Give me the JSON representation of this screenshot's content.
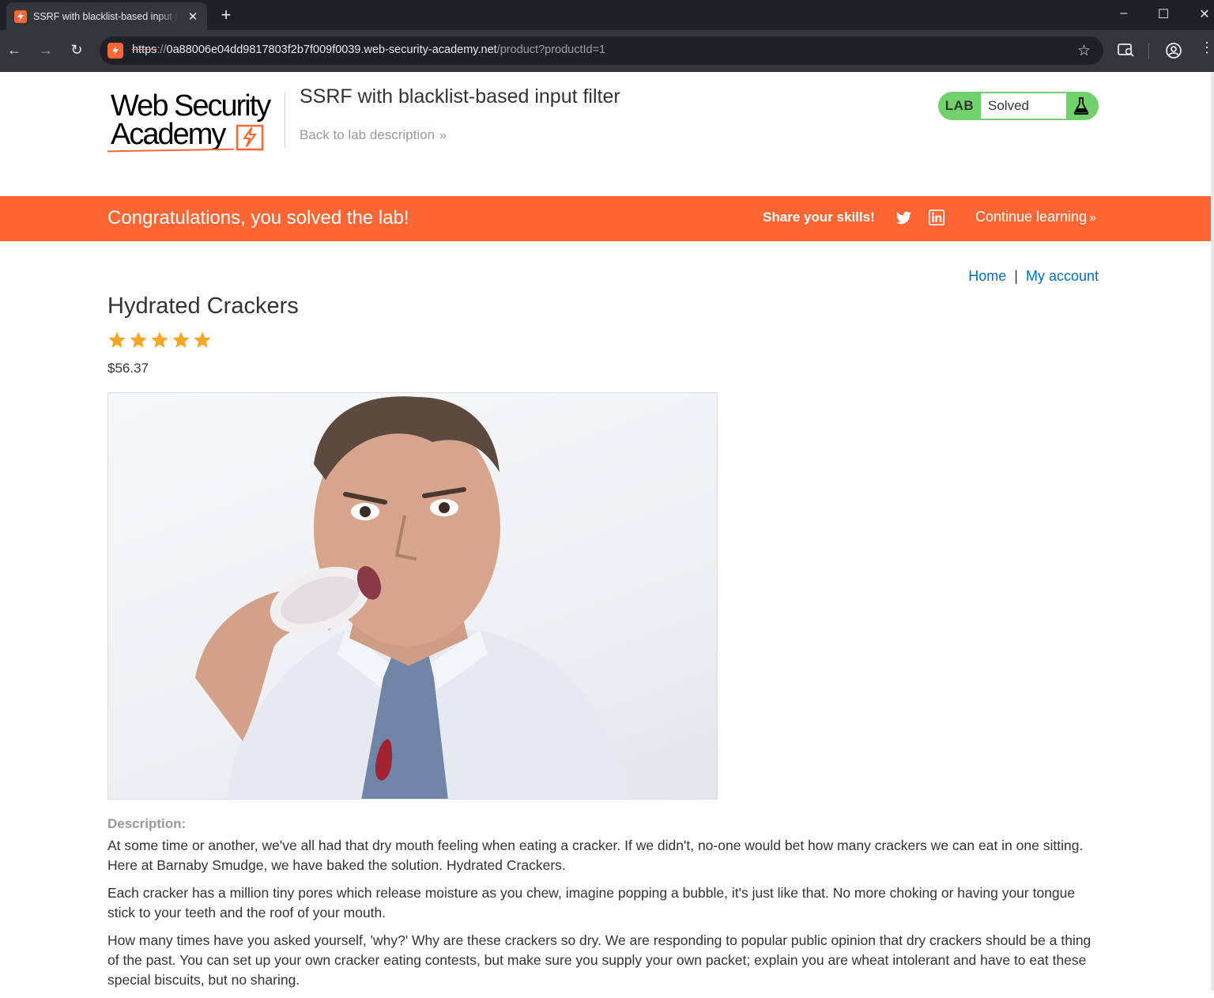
{
  "browser": {
    "tab_title": "SSRF with blacklist-based input filter",
    "new_tab_label": "+",
    "url_scheme": "https",
    "url_separator": "://",
    "url_host": "0a88006e04dd9817803f2b7f009f0039.web-security-academy.net",
    "url_path": "/product?productId=1"
  },
  "header": {
    "logo_line1": "Web Security",
    "logo_line2": "Academy",
    "lab_title": "SSRF with blacklist-based input filter",
    "back_link": "Back to lab description",
    "lab_badge": "LAB",
    "lab_status": "Solved"
  },
  "banner": {
    "message": "Congratulations, you solved the lab!",
    "share_label": "Share your skills!",
    "continue_label": "Continue learning"
  },
  "nav": {
    "home": "Home",
    "separator": "|",
    "my_account": "My account"
  },
  "product": {
    "name": "Hydrated Crackers",
    "rating": 5,
    "rating_max": 5,
    "price": "$56.37",
    "description_label": "Description:",
    "description": [
      "At some time or another, we've all had that dry mouth feeling when eating a cracker. If we didn't, no-one would bet how many crackers we can eat in one sitting. Here at Barnaby Smudge, we have baked the solution. Hydrated Crackers.",
      "Each cracker has a million tiny pores which release moisture as you chew, imagine popping a bubble, it's just like that. No more choking or having your tongue stick to your teeth and the roof of your mouth.",
      "How many times have you asked yourself, 'why?' Why are these crackers so dry. We are responding to popular public opinion that dry crackers should be a thing of the past. You can set up your own cracker eating contests, but make sure you supply your own packet; explain you are wheat intolerant and have to eat these special biscuits, but no sharing."
    ]
  },
  "colors": {
    "accent": "#ff6633",
    "lab_solved": "#70d16d",
    "link": "#0071bc",
    "star": "#f5a623"
  }
}
